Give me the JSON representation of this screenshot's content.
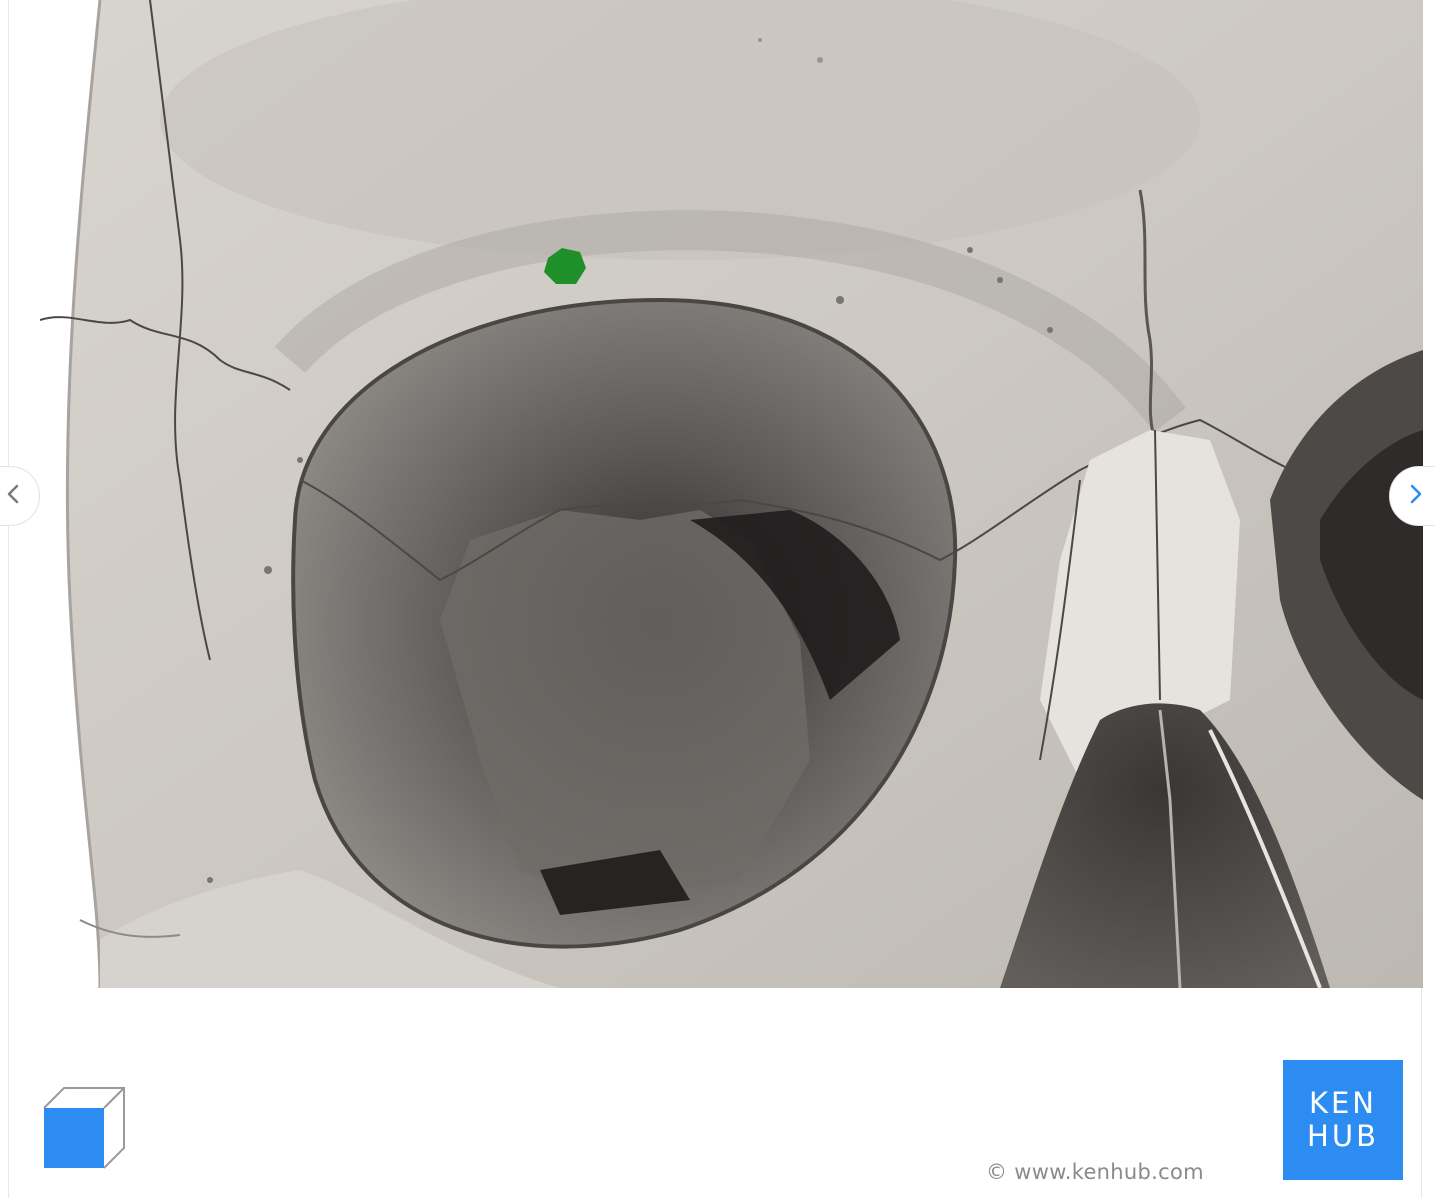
{
  "viewer": {
    "highlight_color": "#1f8f2a",
    "accent_color": "#2c8cf2",
    "prev_icon": "chevron-left-icon",
    "next_icon": "chevron-right-icon",
    "view_icon": "cube-icon"
  },
  "footer": {
    "copyright": "© www.kenhub.com",
    "logo_line1": "KEN",
    "logo_line2": "HUB"
  }
}
